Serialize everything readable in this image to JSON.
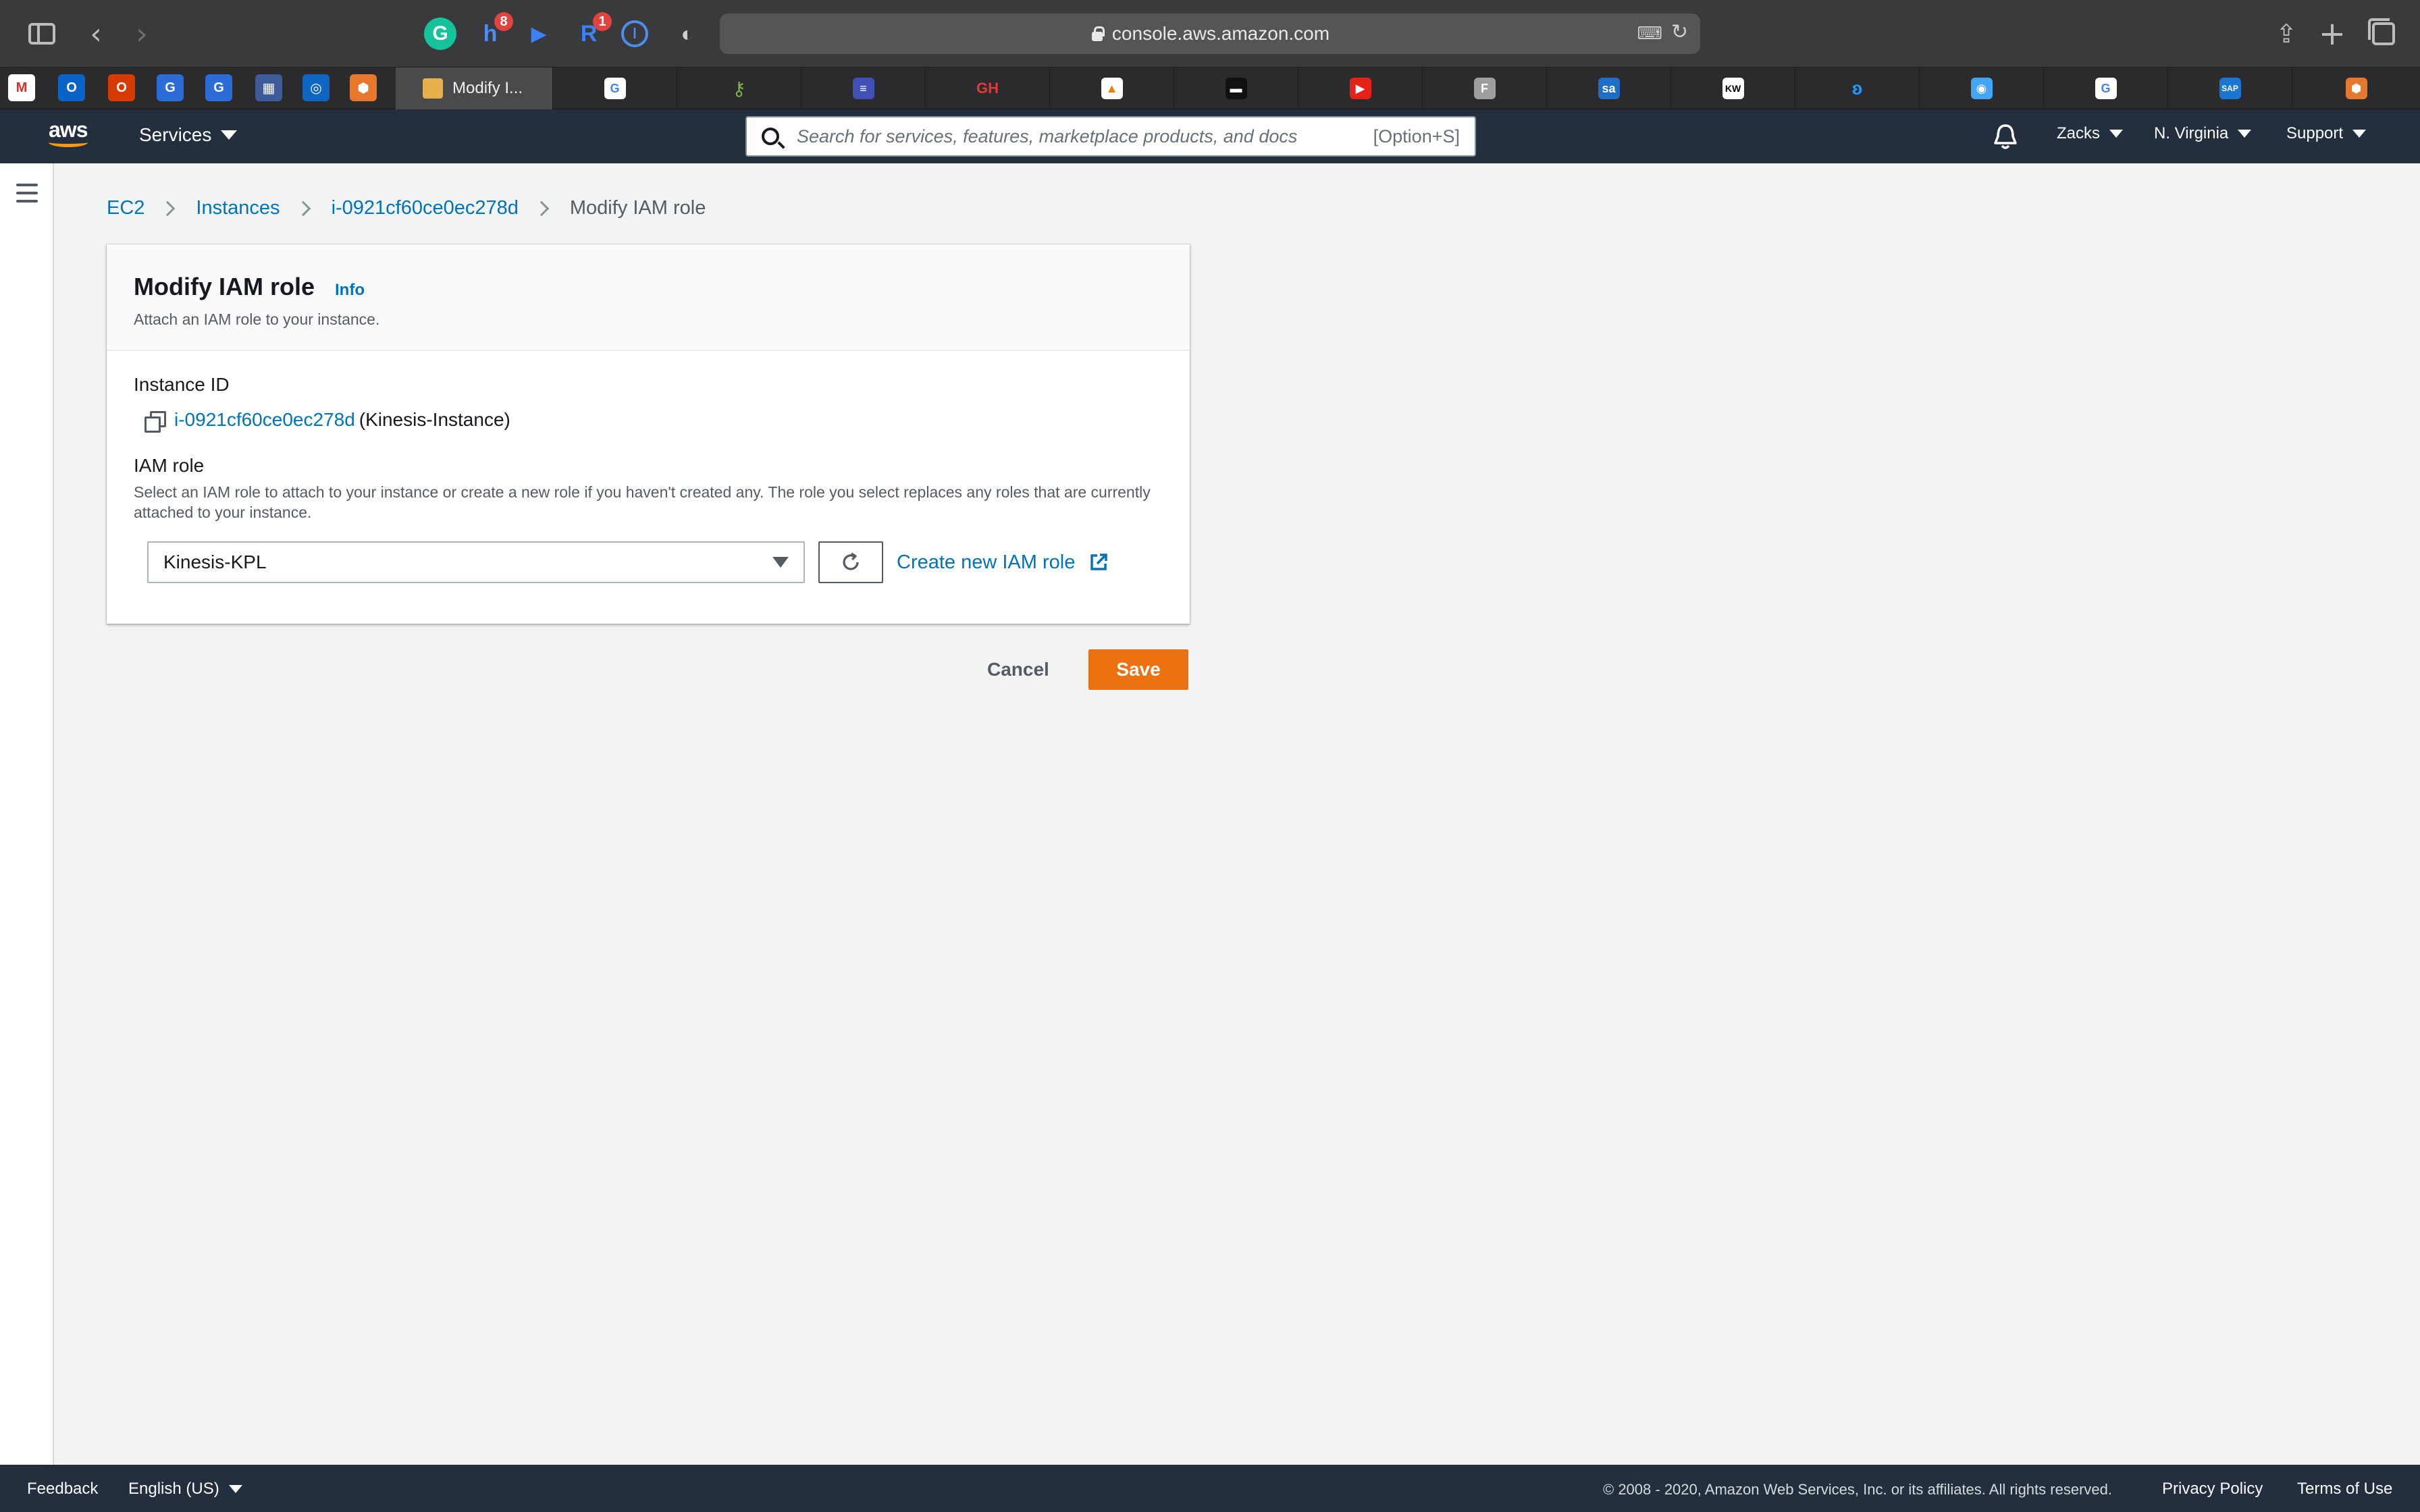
{
  "browser": {
    "url": "console.aws.amazon.com",
    "active_tab_title": "Modify I...",
    "extensions": [
      {
        "name": "grammarly-icon",
        "glyph": "G",
        "color": "#15c39a"
      },
      {
        "name": "honey-icon",
        "glyph": "h",
        "color": "#4a8ef0",
        "badge": "8"
      },
      {
        "name": "play-extension-icon",
        "glyph": "▶",
        "color": "#3b82f6"
      },
      {
        "name": "readwise-icon",
        "glyph": "R",
        "color": "#3b82f6",
        "badge": "1"
      },
      {
        "name": "onepassword-icon",
        "glyph": "①",
        "color": "#4a8ef0"
      },
      {
        "name": "privacy-shield-icon",
        "glyph": "◐",
        "color": "#d0d0d2"
      }
    ]
  },
  "aws_header": {
    "logo_text": "aws",
    "services_label": "Services",
    "search_placeholder": "Search for services, features, marketplace products, and docs",
    "search_shortcut": "[Option+S]",
    "user_label": "Zacks",
    "region_label": "N. Virginia",
    "support_label": "Support"
  },
  "breadcrumb": {
    "items": [
      "EC2",
      "Instances",
      "i-0921cf60ce0ec278d"
    ],
    "current": "Modify IAM role"
  },
  "panel": {
    "title": "Modify IAM role",
    "info_label": "Info",
    "description": "Attach an IAM role to your instance.",
    "instance_id_label": "Instance ID",
    "instance_id": "i-0921cf60ce0ec278d",
    "instance_name": "(Kinesis-Instance)",
    "iam_role_label": "IAM role",
    "iam_role_description": "Select an IAM role to attach to your instance or create a new role if you haven't created any. The role you select replaces any roles that are currently attached to your instance.",
    "selected_role": "Kinesis-KPL",
    "create_role_label": "Create new IAM role"
  },
  "actions": {
    "cancel_label": "Cancel",
    "save_label": "Save"
  },
  "footer": {
    "feedback_label": "Feedback",
    "language_label": "English (US)",
    "copyright": "© 2008 - 2020, Amazon Web Services, Inc. or its affiliates. All rights reserved.",
    "privacy_label": "Privacy Policy",
    "terms_label": "Terms of Use"
  },
  "colors": {
    "header_bg": "#232f3e",
    "link": "#0073bb",
    "primary_button": "#ec7211",
    "page_bg": "#f2f3f3"
  }
}
